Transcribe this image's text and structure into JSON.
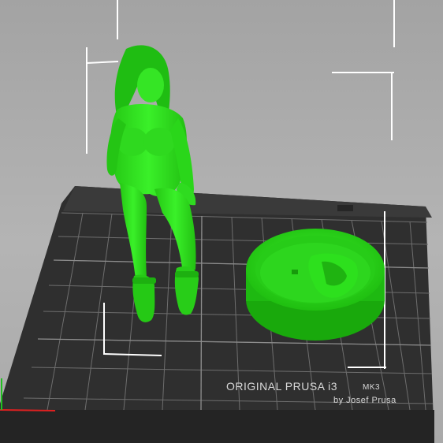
{
  "viewport": {
    "background": "#b0b0b0",
    "model_color": "#2ee51a",
    "bed_color": "#333333",
    "grid_color": "#6a6a6a",
    "bound_color": "#ffffff"
  },
  "bed": {
    "brand_label": "ORIGINAL PRUSA i3",
    "model_label": "MK3",
    "author_label": "by Josef Prusa"
  },
  "objects": [
    {
      "name": "figurine"
    },
    {
      "name": "round-base"
    }
  ],
  "axis_colors": {
    "x": "#e02020",
    "y": "#20c020"
  }
}
